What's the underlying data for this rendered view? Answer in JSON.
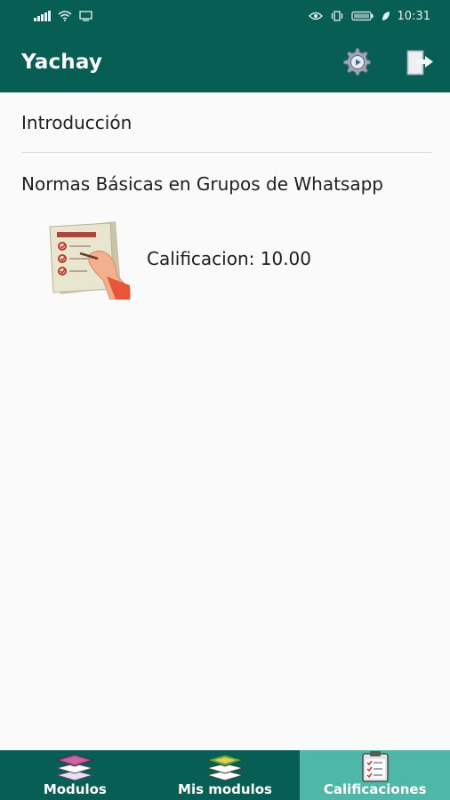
{
  "status_bar": {
    "time": "10:31"
  },
  "app_bar": {
    "title": "Yachay",
    "settings_icon": "gear-icon",
    "logout_icon": "logout-icon"
  },
  "content": {
    "intro_label": "Introducción",
    "module_label": "Normas Básicas en Grupos de Whatsapp",
    "grade_icon": "checklist-hand-icon",
    "grade_text": "Calificacion: 10.00"
  },
  "bottom_nav": {
    "items": [
      {
        "label": "Modulos",
        "icon": "layers-purple-icon",
        "active": false
      },
      {
        "label": "Mis modulos",
        "icon": "layers-green-icon",
        "active": false
      },
      {
        "label": "Calificaciones",
        "icon": "clipboard-icon",
        "active": true
      }
    ]
  },
  "colors": {
    "primary": "#075e54",
    "active_tab": "#4fb7a8",
    "background": "#fafafa"
  }
}
